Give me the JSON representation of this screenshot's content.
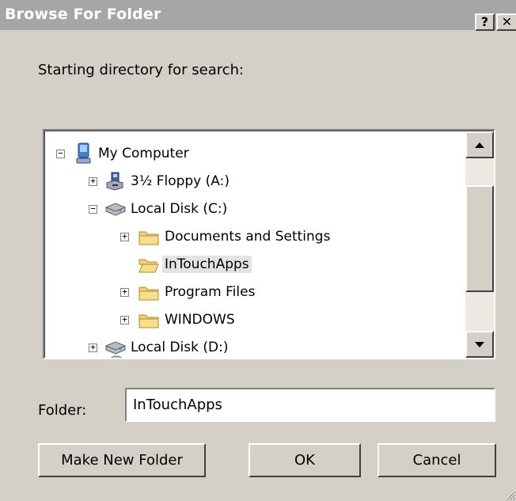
{
  "window": {
    "title": "Browse For Folder",
    "help_label": "?",
    "close_label": "✕"
  },
  "prompt": "Starting directory for search:",
  "tree": {
    "nodes": [
      {
        "label": "My Computer",
        "expander": "−",
        "icon": "computer-icon"
      },
      {
        "label": "3½ Floppy (A:)",
        "expander": "+",
        "icon": "floppy-drive-icon"
      },
      {
        "label": "Local Disk (C:)",
        "expander": "−",
        "icon": "hard-disk-icon"
      },
      {
        "label": "Documents and Settings",
        "expander": "+",
        "icon": "folder-icon"
      },
      {
        "label": "InTouchApps",
        "expander": "",
        "icon": "folder-open-icon",
        "selected": true
      },
      {
        "label": "Program Files",
        "expander": "+",
        "icon": "folder-icon"
      },
      {
        "label": "WINDOWS",
        "expander": "+",
        "icon": "folder-icon"
      },
      {
        "label": "Local Disk (D:)",
        "expander": "+",
        "icon": "hard-disk-icon"
      }
    ]
  },
  "folder": {
    "label": "Folder:",
    "value": "InTouchApps"
  },
  "buttons": {
    "make_new_folder": "Make New Folder",
    "ok": "OK",
    "cancel": "Cancel"
  },
  "colors": {
    "titlebar": "#a6a6a6",
    "face": "#d4d0c8",
    "folder": "#f2d271",
    "selection": "#e3e3e3"
  }
}
